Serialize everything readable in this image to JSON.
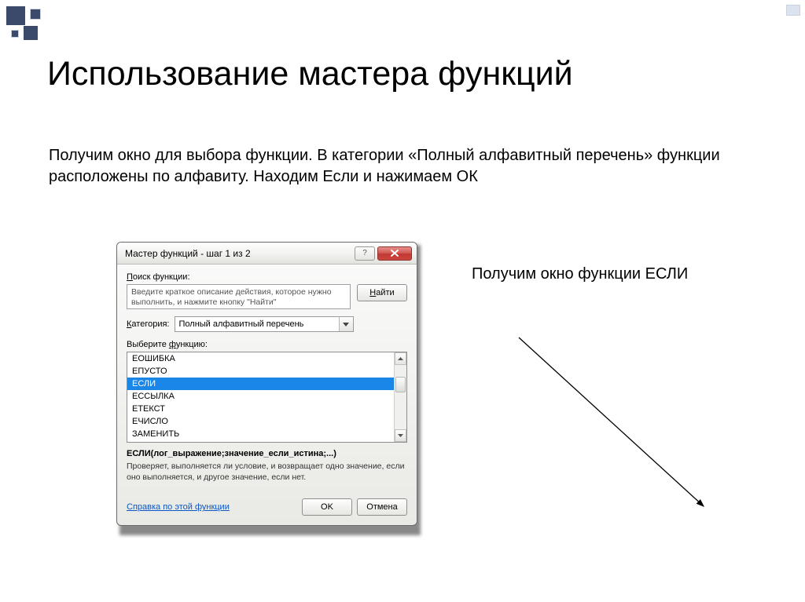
{
  "slide": {
    "title": "Использование мастера функций",
    "intro": "Получим окно для выбора функции. В категории «Полный алфавитный перечень» функции расположены по алфавиту. Находим Если и нажимаем ОК",
    "side": "Получим окно функции ЕСЛИ"
  },
  "dialog": {
    "title": "Мастер функций - шаг 1 из 2",
    "search_label": "Поиск функции:",
    "search_text": "Введите краткое описание действия, которое нужно выполнить, и нажмите кнопку \"Найти\"",
    "find_btn": "Найти",
    "category_label": "Категория:",
    "category_value": "Полный алфавитный перечень",
    "select_label": "Выберите функцию:",
    "items": [
      "ЕОШИБКА",
      "ЕПУСТО",
      "ЕСЛИ",
      "ЕССЫЛКА",
      "ЕТЕКСТ",
      "ЕЧИСЛО",
      "ЗАМЕНИТЬ"
    ],
    "selected_index": 2,
    "syntax": "ЕСЛИ(лог_выражение;значение_если_истина;...)",
    "description": "Проверяет, выполняется ли условие, и возвращает одно значение, если оно выполняется, и другое значение, если нет.",
    "help_link": "Справка по этой функции",
    "ok": "OK",
    "cancel": "Отмена"
  }
}
